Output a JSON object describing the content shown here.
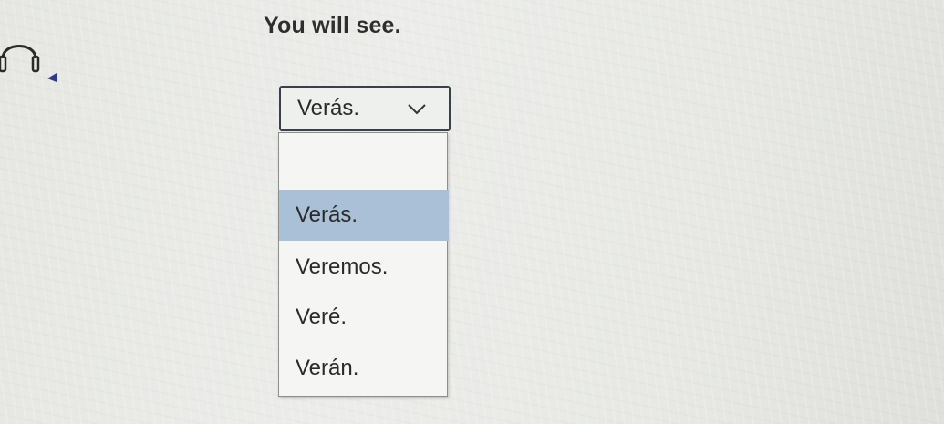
{
  "prompt": {
    "text": "You will see."
  },
  "audio_button": {
    "icon": "headphones-icon"
  },
  "select": {
    "selected_value": "Verás.",
    "icon": "chevron-down-icon",
    "options": [
      {
        "label": ""
      },
      {
        "label": "Verás."
      },
      {
        "label": "Veremos."
      },
      {
        "label": "Veré."
      },
      {
        "label": "Verán."
      }
    ],
    "highlighted_option_index": 1
  },
  "colors": {
    "highlight": "#a9c0d6",
    "border": "#3b3f4a",
    "accent": "#2d3c8a"
  }
}
